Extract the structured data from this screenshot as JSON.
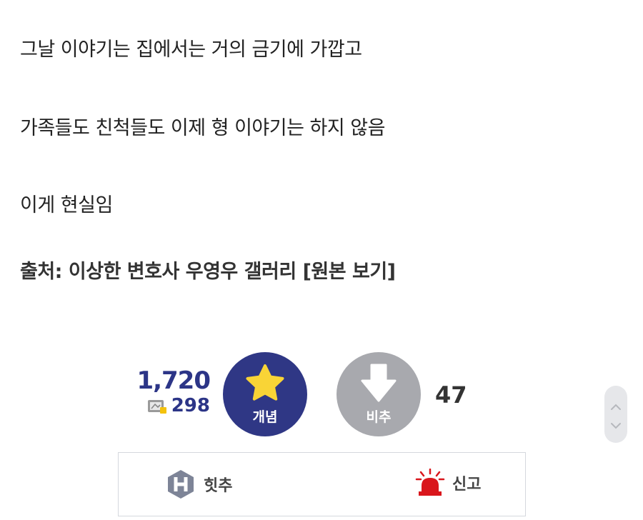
{
  "post": {
    "line1": "그날 이야기는 집에서는 거의 금기에 가깝고",
    "line2": "가족들도 친척들도 이제 형 이야기는 하지 않음",
    "line3": "이게 현실임",
    "source_prefix": "출처: ",
    "source_gallery": "이상한 변호사 우영우 갤러리",
    "source_link": "[원본 보기]"
  },
  "votes": {
    "up_count": "1,720",
    "fixnik_count": "298",
    "up_label": "개념",
    "down_label": "비추",
    "down_count": "47"
  },
  "actions": {
    "hit_label": "힛추",
    "report_label": "신고"
  },
  "icons": {
    "star": "star-icon",
    "down_arrow": "down-arrow-icon",
    "fixnik": "fixed-nick-icon",
    "hit": "hit-icon",
    "siren": "siren-icon",
    "scroll_up": "chevron-up-icon",
    "scroll_down": "chevron-down-icon"
  },
  "colors": {
    "upvote": "#2f3785",
    "downvote": "#a8a9ae",
    "star": "#f9d436",
    "count_text": "#2c3587",
    "siren": "#d9161c"
  }
}
